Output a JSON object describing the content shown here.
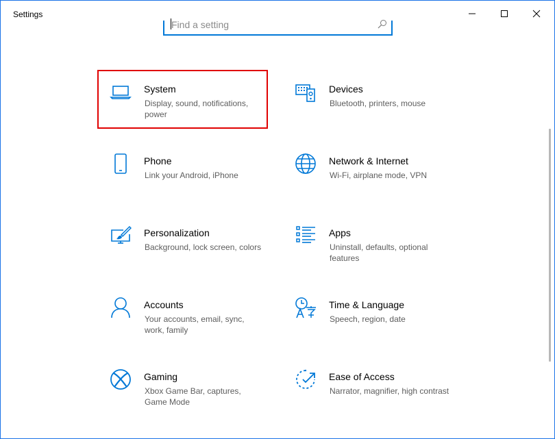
{
  "window": {
    "title": "Settings",
    "controls": {
      "minimize": "minimize-icon",
      "maximize": "maximize-icon",
      "close": "close-icon"
    }
  },
  "search": {
    "placeholder": "Find a setting",
    "icon": "search-icon"
  },
  "colors": {
    "accent": "#0078d7",
    "highlight": "#e00000",
    "desc_text": "#5d5d5d"
  },
  "tiles": [
    {
      "name": "System",
      "desc": "Display, sound, notifications, power",
      "icon": "laptop-icon",
      "selected": true
    },
    {
      "name": "Devices",
      "desc": "Bluetooth, printers, mouse",
      "icon": "keyboard-speaker-icon",
      "selected": false
    },
    {
      "name": "Phone",
      "desc": "Link your Android, iPhone",
      "icon": "phone-icon",
      "selected": false
    },
    {
      "name": "Network & Internet",
      "desc": "Wi-Fi, airplane mode, VPN",
      "icon": "globe-icon",
      "selected": false
    },
    {
      "name": "Personalization",
      "desc": "Background, lock screen, colors",
      "icon": "paint-brush-monitor-icon",
      "selected": false
    },
    {
      "name": "Apps",
      "desc": "Uninstall, defaults, optional features",
      "icon": "apps-list-icon",
      "selected": false
    },
    {
      "name": "Accounts",
      "desc": "Your accounts, email, sync, work, family",
      "icon": "person-icon",
      "selected": false
    },
    {
      "name": "Time & Language",
      "desc": "Speech, region, date",
      "icon": "time-language-icon",
      "selected": false
    },
    {
      "name": "Gaming",
      "desc": "Xbox Game Bar, captures, Game Mode",
      "icon": "xbox-icon",
      "selected": false
    },
    {
      "name": "Ease of Access",
      "desc": "Narrator, magnifier, high contrast",
      "icon": "ease-of-access-icon",
      "selected": false
    }
  ]
}
